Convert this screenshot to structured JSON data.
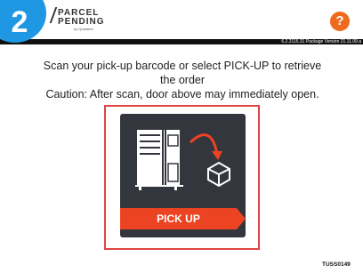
{
  "step": {
    "number": "2"
  },
  "header": {
    "logo_line1": "PARCEL",
    "logo_line2": "PENDING",
    "logo_sub": "by Quadient",
    "help_label": "?"
  },
  "version": {
    "text": "6.2.2115.31  Package Version  21.11.09.a"
  },
  "instructions": {
    "line1": "Scan your pick-up barcode or select PICK-UP to retrieve",
    "line2": "the order",
    "line3": "Caution: After scan, door above may immediately open."
  },
  "pickup": {
    "label": "PICK UP"
  },
  "footer": {
    "kiosk_id": "TUSS0149"
  },
  "colors": {
    "badge_blue": "#1f97e2",
    "help_orange": "#f06a1e",
    "tile_dark": "#34363d",
    "pickup_red": "#ec4323",
    "frame_red": "#e04343"
  }
}
